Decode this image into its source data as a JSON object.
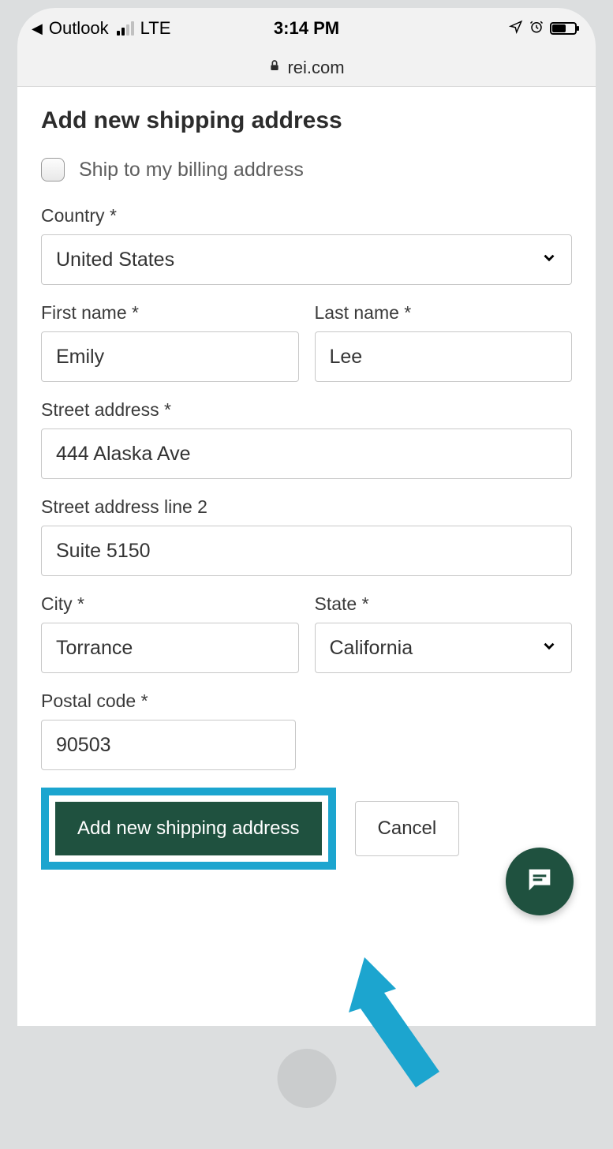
{
  "statusbar": {
    "back_app": "Outlook",
    "network": "LTE",
    "time": "3:14 PM"
  },
  "urlbar": {
    "domain": "rei.com"
  },
  "form": {
    "title": "Add new shipping address",
    "ship_to_billing_label": "Ship to my billing address",
    "country_label": "Country",
    "country_value": "United States",
    "first_name_label": "First name",
    "first_name_value": "Emily",
    "last_name_label": "Last name",
    "last_name_value": "Lee",
    "street_label": "Street address",
    "street_value": "444 Alaska Ave",
    "street2_label": "Street address line 2",
    "street2_value": "Suite 5150",
    "city_label": "City",
    "city_value": "Torrance",
    "state_label": "State",
    "state_value": "California",
    "postal_label": "Postal code",
    "postal_value": "90503",
    "submit_label": "Add new shipping address",
    "cancel_label": "Cancel",
    "required_mark": "*"
  }
}
